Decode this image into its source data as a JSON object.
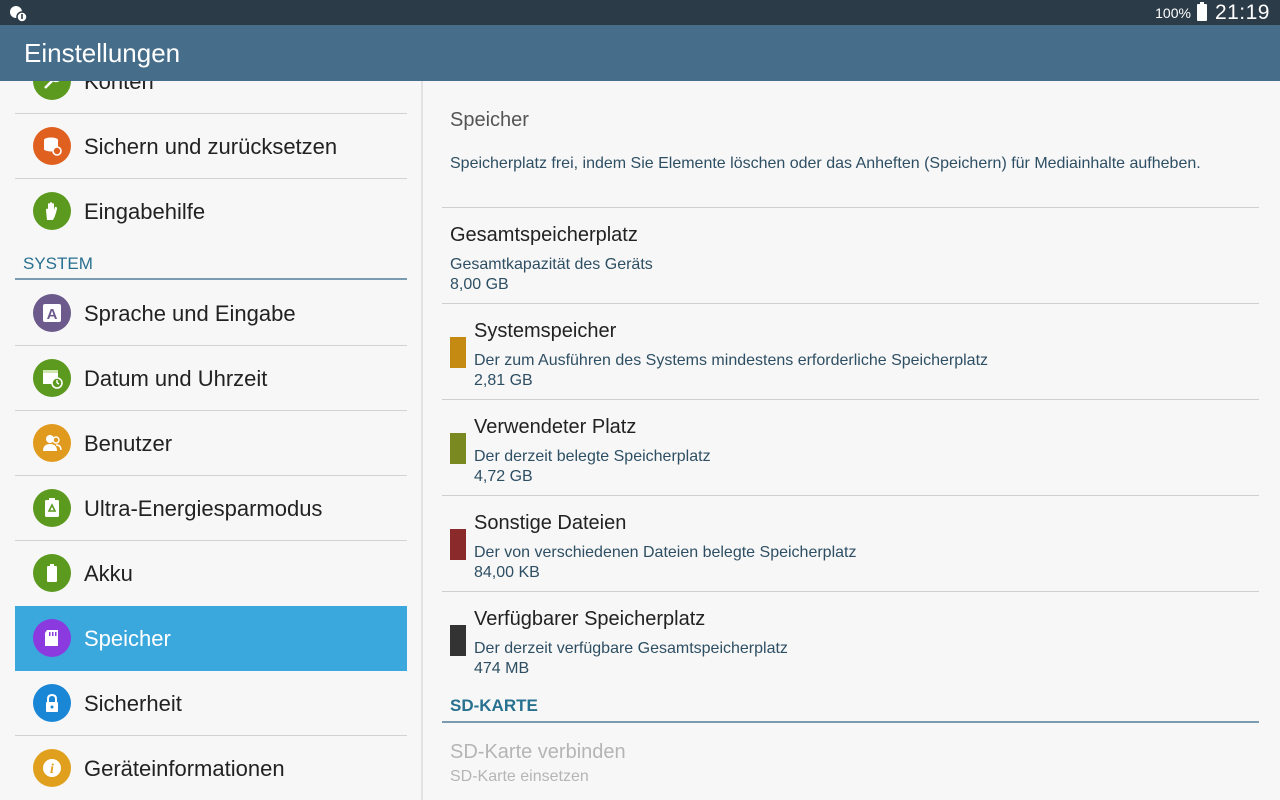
{
  "status_bar": {
    "battery_percent": "100%",
    "time": "21:19"
  },
  "action_bar": {
    "title": "Einstellungen"
  },
  "sidebar": {
    "partial_item": {
      "label": "Konten",
      "icon": "key-icon",
      "color": "#5b9a1e"
    },
    "items_top": [
      {
        "label": "Sichern und zurücksetzen",
        "icon": "backup-icon",
        "color": "#e06020"
      },
      {
        "label": "Eingabehilfe",
        "icon": "hand-icon",
        "color": "#5b9a1e"
      }
    ],
    "section_label": "SYSTEM",
    "items": [
      {
        "label": "Sprache und Eingabe",
        "icon": "language-icon",
        "color": "#6c5a8c"
      },
      {
        "label": "Datum und Uhrzeit",
        "icon": "calendar-clock-icon",
        "color": "#5b9a1e"
      },
      {
        "label": "Benutzer",
        "icon": "users-icon",
        "color": "#e09a1e"
      },
      {
        "label": "Ultra-Energiesparmodus",
        "icon": "recycle-battery-icon",
        "color": "#5b9a1e"
      },
      {
        "label": "Akku",
        "icon": "battery-icon",
        "color": "#5b9a1e"
      },
      {
        "label": "Speicher",
        "icon": "sd-card-icon",
        "color": "#8a3adf",
        "active": true
      },
      {
        "label": "Sicherheit",
        "icon": "lock-icon",
        "color": "#1a86d6"
      },
      {
        "label": "Geräteinformationen",
        "icon": "info-icon",
        "color": "#e0a01e"
      }
    ]
  },
  "main": {
    "header": "Speicher",
    "description": "Speicherplatz frei, indem Sie Elemente löschen oder das Anheften (Speichern) für Mediainhalte aufheben.",
    "total": {
      "title": "Gesamtspeicherplatz",
      "subtitle": "Gesamtkapazität des Geräts",
      "value": "8,00 GB"
    },
    "storage_rows": [
      {
        "title": "Systemspeicher",
        "subtitle": "Der zum Ausführen des Systems mindestens erforderliche Speicherplatz",
        "value": "2,81 GB",
        "color": "#c48a12"
      },
      {
        "title": "Verwendeter Platz",
        "subtitle": "Der derzeit belegte Speicherplatz",
        "value": "4,72 GB",
        "color": "#7a8a20"
      },
      {
        "title": "Sonstige Dateien",
        "subtitle": "Der von verschiedenen Dateien belegte Speicherplatz",
        "value": "84,00 KB",
        "color": "#8a2a2a"
      },
      {
        "title": "Verfügbarer Speicherplatz",
        "subtitle": "Der derzeit verfügbare Gesamtspeicherplatz",
        "value": "474 MB",
        "color": "#333333"
      }
    ],
    "sd_section": {
      "label": "SD-KARTE",
      "title": "SD-Karte verbinden",
      "subtitle": "SD-Karte einsetzen"
    }
  }
}
